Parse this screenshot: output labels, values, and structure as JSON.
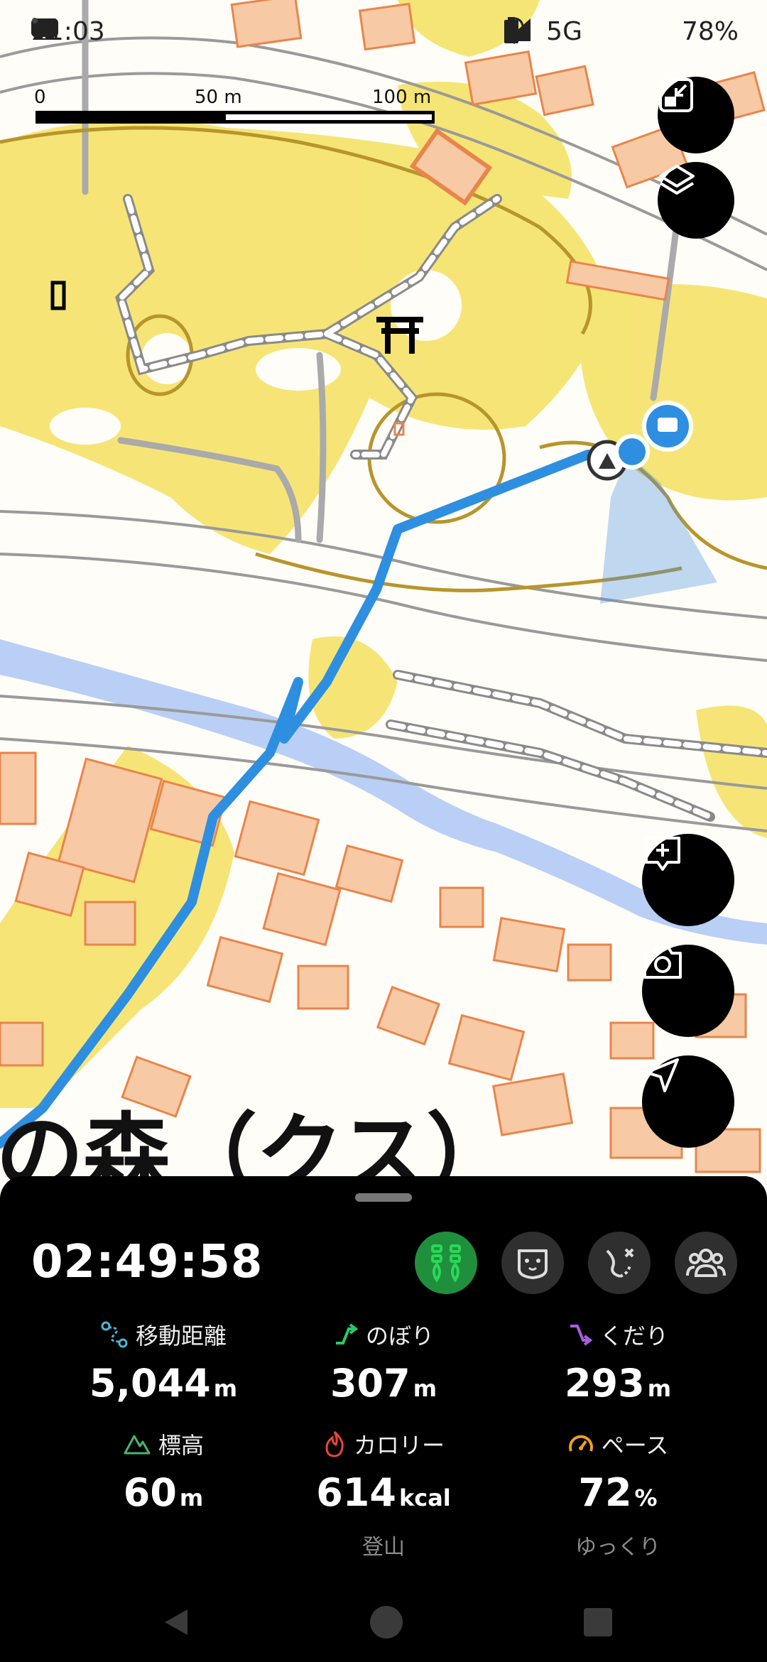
{
  "status_bar": {
    "time": "11:03",
    "network": "5G",
    "battery": "78%"
  },
  "scale": {
    "labels": [
      "0",
      "50 m",
      "100 m"
    ]
  },
  "map": {
    "place_label": "の森（クス）"
  },
  "icons": {
    "fab_top": [
      "fullscreen-exit-icon",
      "layers-icon"
    ],
    "fab_bottom": [
      "add-comment-icon",
      "camera-icon",
      "navigation-arrow-icon"
    ],
    "modes": [
      "hiking-poles-icon",
      "dog-face-icon",
      "route-off-icon",
      "group-icon"
    ]
  },
  "colors": {
    "track": "#2e8fe0",
    "map_park": "#f3e06a",
    "map_building": "#f7c9a4",
    "building_outline": "#e8854b",
    "active_mode": "#1f8f3c"
  },
  "sheet": {
    "elapsed_time": "02:49:58",
    "stats": {
      "distance": {
        "label": "移動距離",
        "value": "5,044",
        "unit": "m"
      },
      "ascent": {
        "label": "のぼり",
        "value": "307",
        "unit": "m"
      },
      "descent": {
        "label": "くだり",
        "value": "293",
        "unit": "m"
      },
      "altitude": {
        "label": "標高",
        "value": "60",
        "unit": "m"
      },
      "calories": {
        "label": "カロリー",
        "value": "614",
        "unit": "kcal",
        "sub": "登山"
      },
      "pace": {
        "label": "ペース",
        "value": "72",
        "unit": "%",
        "sub": "ゆっくり"
      }
    }
  }
}
